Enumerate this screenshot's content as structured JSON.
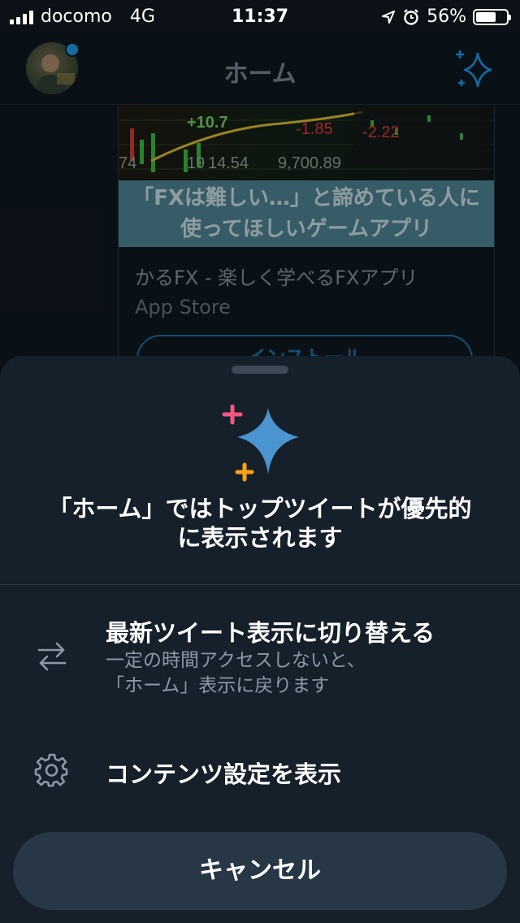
{
  "status_bar": {
    "carrier": "docomo",
    "network": "4G",
    "time": "11:37",
    "battery": "56%"
  },
  "header": {
    "title": "ホーム",
    "avatar_icon": "profile-avatar",
    "sparkle_icon": "sparkle-icon"
  },
  "card": {
    "image_numbers": [
      "+10.7",
      "-1.85",
      "-2.22",
      "14.54",
      "9,700.89",
      "74",
      "19"
    ],
    "banner_line1": "「FXは難しい…」と諦めている人に",
    "banner_line2": "使ってほしいゲームアプリ",
    "title": "かるFX - 楽しく学べるFXアプリ",
    "source": "App Store",
    "install_label": "インストール"
  },
  "sheet": {
    "title_line1": "「ホーム」ではトップツイートが優先的",
    "title_line2": "に表示されます",
    "options": [
      {
        "icon": "swap-arrows-icon",
        "label": "最新ツイート表示に切り替える",
        "desc_line1": "一定の時間アクセスしないと、",
        "desc_line2": "「ホーム」表示に戻ります"
      },
      {
        "icon": "gear-icon",
        "label": "コンテンツ設定を表示"
      }
    ],
    "cancel_label": "キャンセル"
  },
  "colors": {
    "accent": "#1d9bf0",
    "sheet_bg": "#15202b",
    "sparkle_pink": "#f4577f",
    "sparkle_orange": "#f7a218"
  }
}
